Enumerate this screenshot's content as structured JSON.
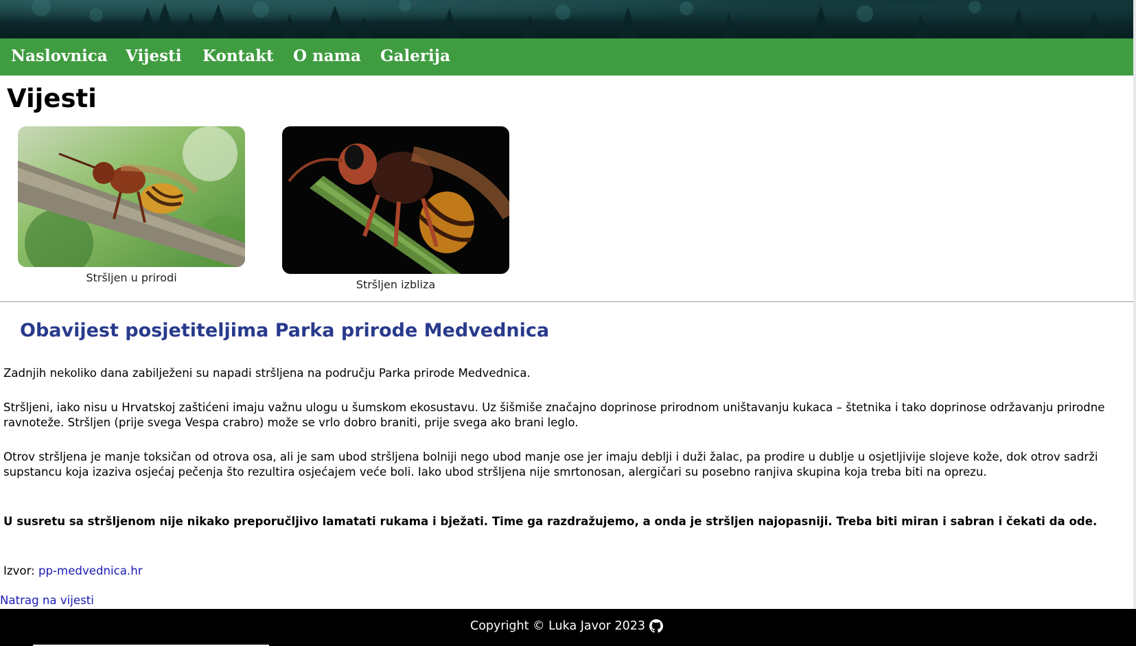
{
  "nav": {
    "items": [
      {
        "label": "Naslovnica"
      },
      {
        "label": "Vijesti"
      },
      {
        "label": "Kontakt"
      },
      {
        "label": "O nama"
      },
      {
        "label": "Galerija"
      }
    ]
  },
  "page": {
    "title": "Vijesti"
  },
  "gallery": [
    {
      "caption": "Stršljen u prirodi"
    },
    {
      "caption": "Stršljen izbliza"
    }
  ],
  "article": {
    "heading": "Obavijest posjetiteljima Parka prirode Medvednica",
    "p1": "Zadnjih nekoliko dana zabilježeni su napadi stršljena na području Parka prirode Medvednica.",
    "p2": "Stršljeni, iako nisu u Hrvatskoj zaštićeni imaju važnu ulogu u šumskom ekosustavu. Uz šišmiše značajno doprinose prirodnom uništavanju kukaca – štetnika i tako doprinose održavanju prirodne ravnoteže. Stršljen (prije svega Vespa crabro) može se vrlo dobro braniti, prije svega ako brani leglo.",
    "p3": "Otrov stršljena je manje toksičan od otrova osa, ali je sam ubod stršljena bolniji nego ubod manje ose jer imaju deblji i duži žalac, pa prodire u dublje u osjetljivije slojeve kože, dok otrov sadrži supstancu koja izaziva osjećaj pečenja što rezultira osjećajem veće boli. Iako ubod stršljena nije smrtonosan, alergičari su posebno ranjiva skupina koja treba biti na oprezu.",
    "warning": "U susretu sa stršljenom nije nikako preporučljivo lamatati rukama i bježati. Time ga razdražujemo, a onda je stršljen najopasniji. Treba biti miran i sabran i čekati da ode.",
    "source_label": "Izvor: ",
    "source_link": "pp-medvednica.hr",
    "back_link": "Natrag na vijesti"
  },
  "footer": {
    "text": "Copyright © Luka Javor 2023",
    "icon": "github-icon"
  },
  "colors": {
    "nav": "#409c41",
    "heading": "#283a8c",
    "link": "#1a1ab5",
    "footer": "#000000"
  }
}
